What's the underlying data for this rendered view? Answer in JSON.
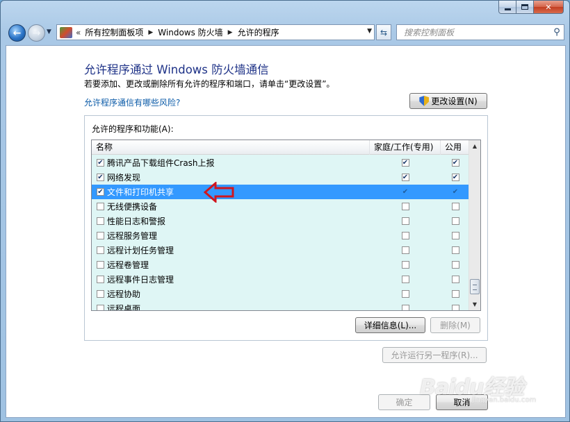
{
  "window": {
    "caption_buttons": {
      "minimize": "",
      "maximize": "",
      "close": "✕"
    }
  },
  "nav": {
    "address_prefix": "«",
    "breadcrumbs": [
      "所有控制面板项",
      "Windows 防火墙",
      "允许的程序"
    ],
    "search_placeholder": "搜索控制面板"
  },
  "page": {
    "title": "允许程序通过 Windows 防火墙通信",
    "description": "若要添加、更改或删除所有允许的程序和端口，请单击“更改设置”。",
    "risk_link": "允许程序通信有哪些风险?",
    "change_settings_button": "更改设置(N)"
  },
  "group": {
    "label": "允许的程序和功能(A):",
    "columns": [
      "名称",
      "家庭/工作(专用)",
      "公用"
    ],
    "rows": [
      {
        "name": "腾讯产品下载组件Crash上报",
        "enabled": true,
        "home": true,
        "public": true,
        "selected": false
      },
      {
        "name": "网络发现",
        "enabled": true,
        "home": true,
        "public": true,
        "selected": false
      },
      {
        "name": "文件和打印机共享",
        "enabled": true,
        "home": true,
        "public": true,
        "selected": true
      },
      {
        "name": "无线便携设备",
        "enabled": false,
        "home": false,
        "public": false,
        "selected": false
      },
      {
        "name": "性能日志和警报",
        "enabled": false,
        "home": false,
        "public": false,
        "selected": false
      },
      {
        "name": "远程服务管理",
        "enabled": false,
        "home": false,
        "public": false,
        "selected": false
      },
      {
        "name": "远程计划任务管理",
        "enabled": false,
        "home": false,
        "public": false,
        "selected": false
      },
      {
        "name": "远程卷管理",
        "enabled": false,
        "home": false,
        "public": false,
        "selected": false
      },
      {
        "name": "远程事件日志管理",
        "enabled": false,
        "home": false,
        "public": false,
        "selected": false
      },
      {
        "name": "远程协助",
        "enabled": false,
        "home": false,
        "public": false,
        "selected": false
      },
      {
        "name": "远程桌面",
        "enabled": false,
        "home": false,
        "public": false,
        "selected": false
      }
    ],
    "details_button": "详细信息(L)...",
    "delete_button": "删除(M)"
  },
  "footer": {
    "allow_another_button": "允许运行另一程序(R)...",
    "ok_button": "确定",
    "cancel_button": "取消"
  },
  "watermark": {
    "logo": "Baidu经验",
    "url": "jingyan.baidu.com"
  },
  "colors": {
    "title": "#1e3287",
    "link": "#0b5ba8",
    "selection": "#3399ff",
    "list_background": "#dff6f5",
    "annotation_arrow": "#d0161e"
  },
  "icons": {
    "back": "back-arrow-icon",
    "forward": "forward-arrow-icon",
    "refresh": "refresh-icon",
    "search": "search-icon",
    "uac": "uac-shield-icon"
  }
}
